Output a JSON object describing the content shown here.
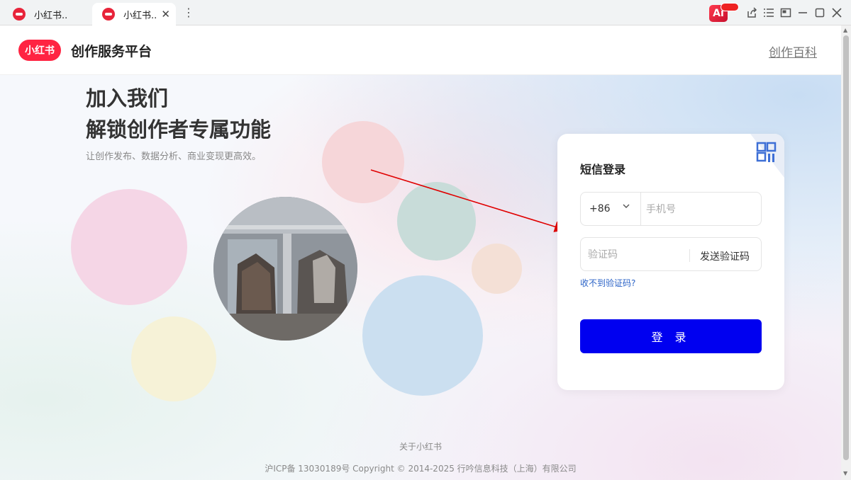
{
  "browser": {
    "tabs": [
      {
        "title": "小红书.."
      },
      {
        "title": "小红书.."
      }
    ],
    "ai_label": "Ai"
  },
  "header": {
    "logo_text": "小红书",
    "title": "创作服务平台",
    "wiki_link": "创作百科"
  },
  "hero": {
    "line1": "加入我们",
    "line2": "解锁创作者专属功能",
    "subtitle": "让创作发布、数据分析、商业变现更高效。"
  },
  "login": {
    "title": "短信登录",
    "country_code": "+86",
    "phone_placeholder": "手机号",
    "code_placeholder": "验证码",
    "send_code": "发送验证码",
    "no_code": "收不到验证码?",
    "submit": "登 录"
  },
  "footer": {
    "about": "关于小红书",
    "copyright": "沪ICP备 13030189号 Copyright © 2014-2025 行吟信息科技（上海）有限公司"
  },
  "colors": {
    "brand": "#ff2442",
    "login_button": "#0000f0",
    "link": "#2b63c7",
    "annotation_arrow": "#e00000"
  }
}
